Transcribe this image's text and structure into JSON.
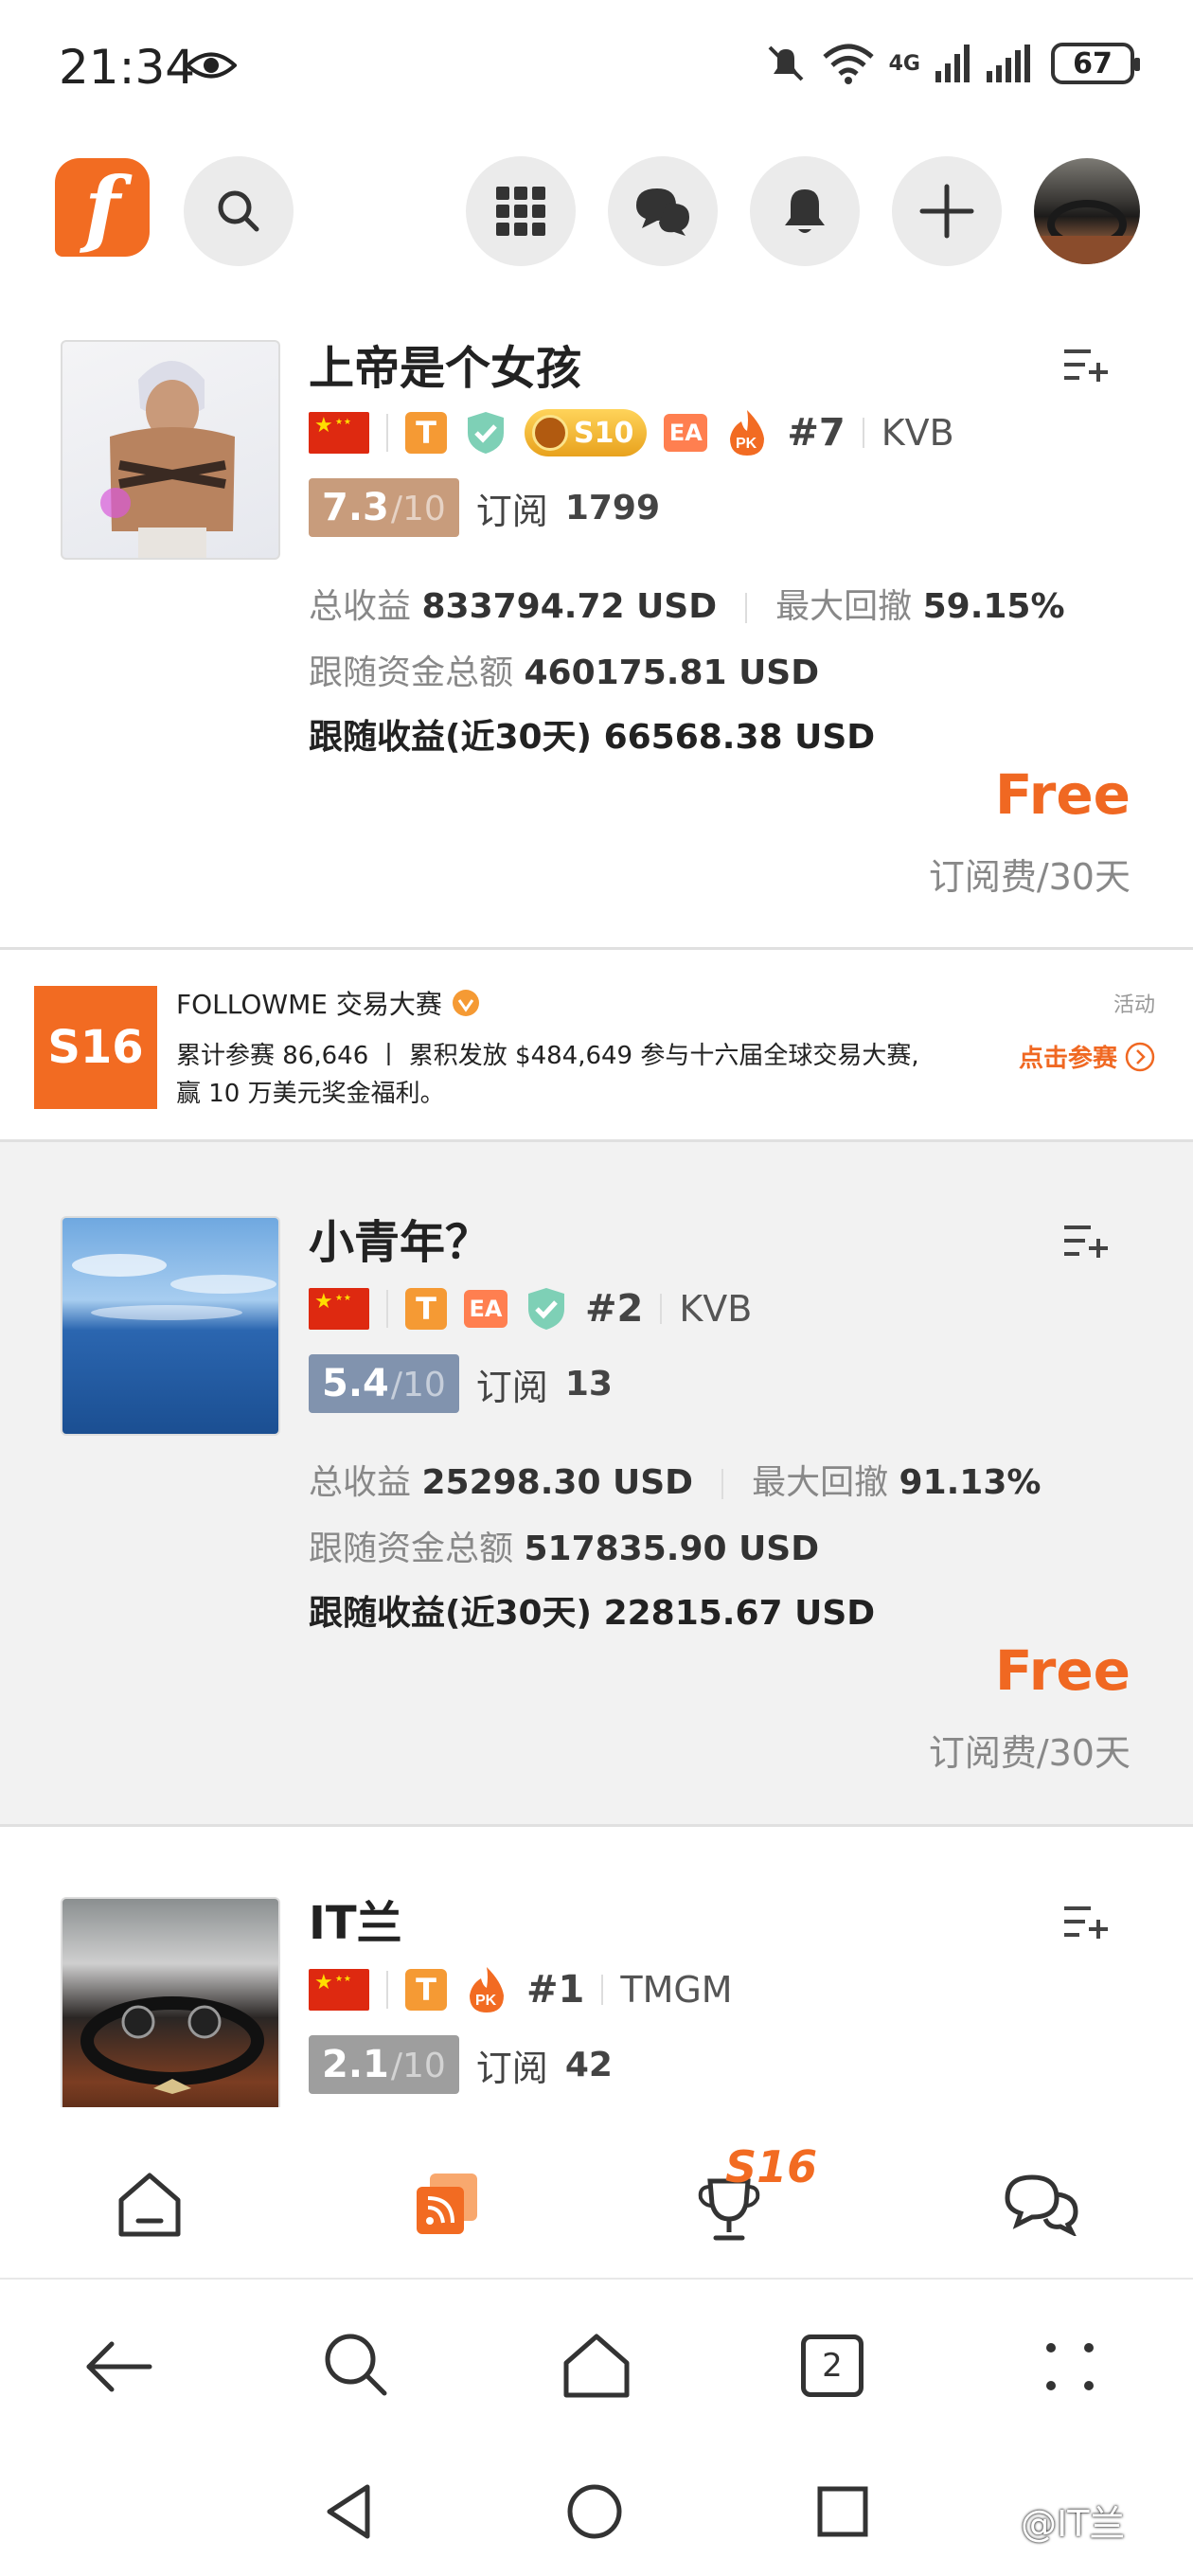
{
  "status_bar": {
    "time": "21:34",
    "battery": "67",
    "network": "4G"
  },
  "header": {
    "logo_letter": "f",
    "icons": [
      "search-icon",
      "grid-icon",
      "chat-icon",
      "bell-icon",
      "plus-icon",
      "avatar"
    ]
  },
  "traders": [
    {
      "name": "上帝是个女孩",
      "rank": "#7",
      "broker": "KVB",
      "season_badge": "S10",
      "score": "7.3",
      "score_denom": "/10",
      "score_color": "#c89c7c",
      "subscribe_label": "订阅",
      "subscribers": "1799",
      "total_profit_label": "总收益",
      "total_profit": "833794.72 USD",
      "max_drawdown_label": "最大回撤",
      "max_drawdown": "59.15%",
      "follow_funds_label": "跟随资金总额",
      "follow_funds": "460175.81 USD",
      "follow_profit_label": "跟随收益(近30天)",
      "follow_profit": "66568.38 USD",
      "price": "Free",
      "fee_label": "订阅费/30天"
    },
    {
      "name": "小青年？",
      "rank": "#2",
      "broker": "KVB",
      "score": "5.4",
      "score_denom": "/10",
      "score_color": "#8193ae",
      "subscribe_label": "订阅",
      "subscribers": "13",
      "total_profit_label": "总收益",
      "total_profit": "25298.30 USD",
      "max_drawdown_label": "最大回撤",
      "max_drawdown": "91.13%",
      "follow_funds_label": "跟随资金总额",
      "follow_funds": "517835.90 USD",
      "follow_profit_label": "跟随收益(近30天)",
      "follow_profit": "22815.67 USD",
      "price": "Free",
      "fee_label": "订阅费/30天"
    },
    {
      "name": "IT兰",
      "rank": "#1",
      "broker": "TMGM",
      "score": "2.1",
      "score_denom": "/10",
      "score_color": "#9e9e9e",
      "subscribe_label": "订阅",
      "subscribers": "42"
    }
  ],
  "banner": {
    "logo": "S16",
    "title": "FOLLOWME 交易大赛",
    "tag": "活动",
    "text_line1": "累计参赛 86,646 丨 累积发放 $484,649 参与十六届全球交易大赛,",
    "text_line2": "赢 10 万美元奖金福利。",
    "cta": "点击参赛"
  },
  "tabbar": {
    "items": [
      "home-icon",
      "feed-icon",
      "trophy-icon",
      "message-icon"
    ],
    "trophy_badge": "S16"
  },
  "browser": {
    "tab_count": "2"
  },
  "watermark": "@IT兰",
  "colors": {
    "brand": "#f26b22",
    "text": "#222222",
    "muted": "#888888"
  }
}
